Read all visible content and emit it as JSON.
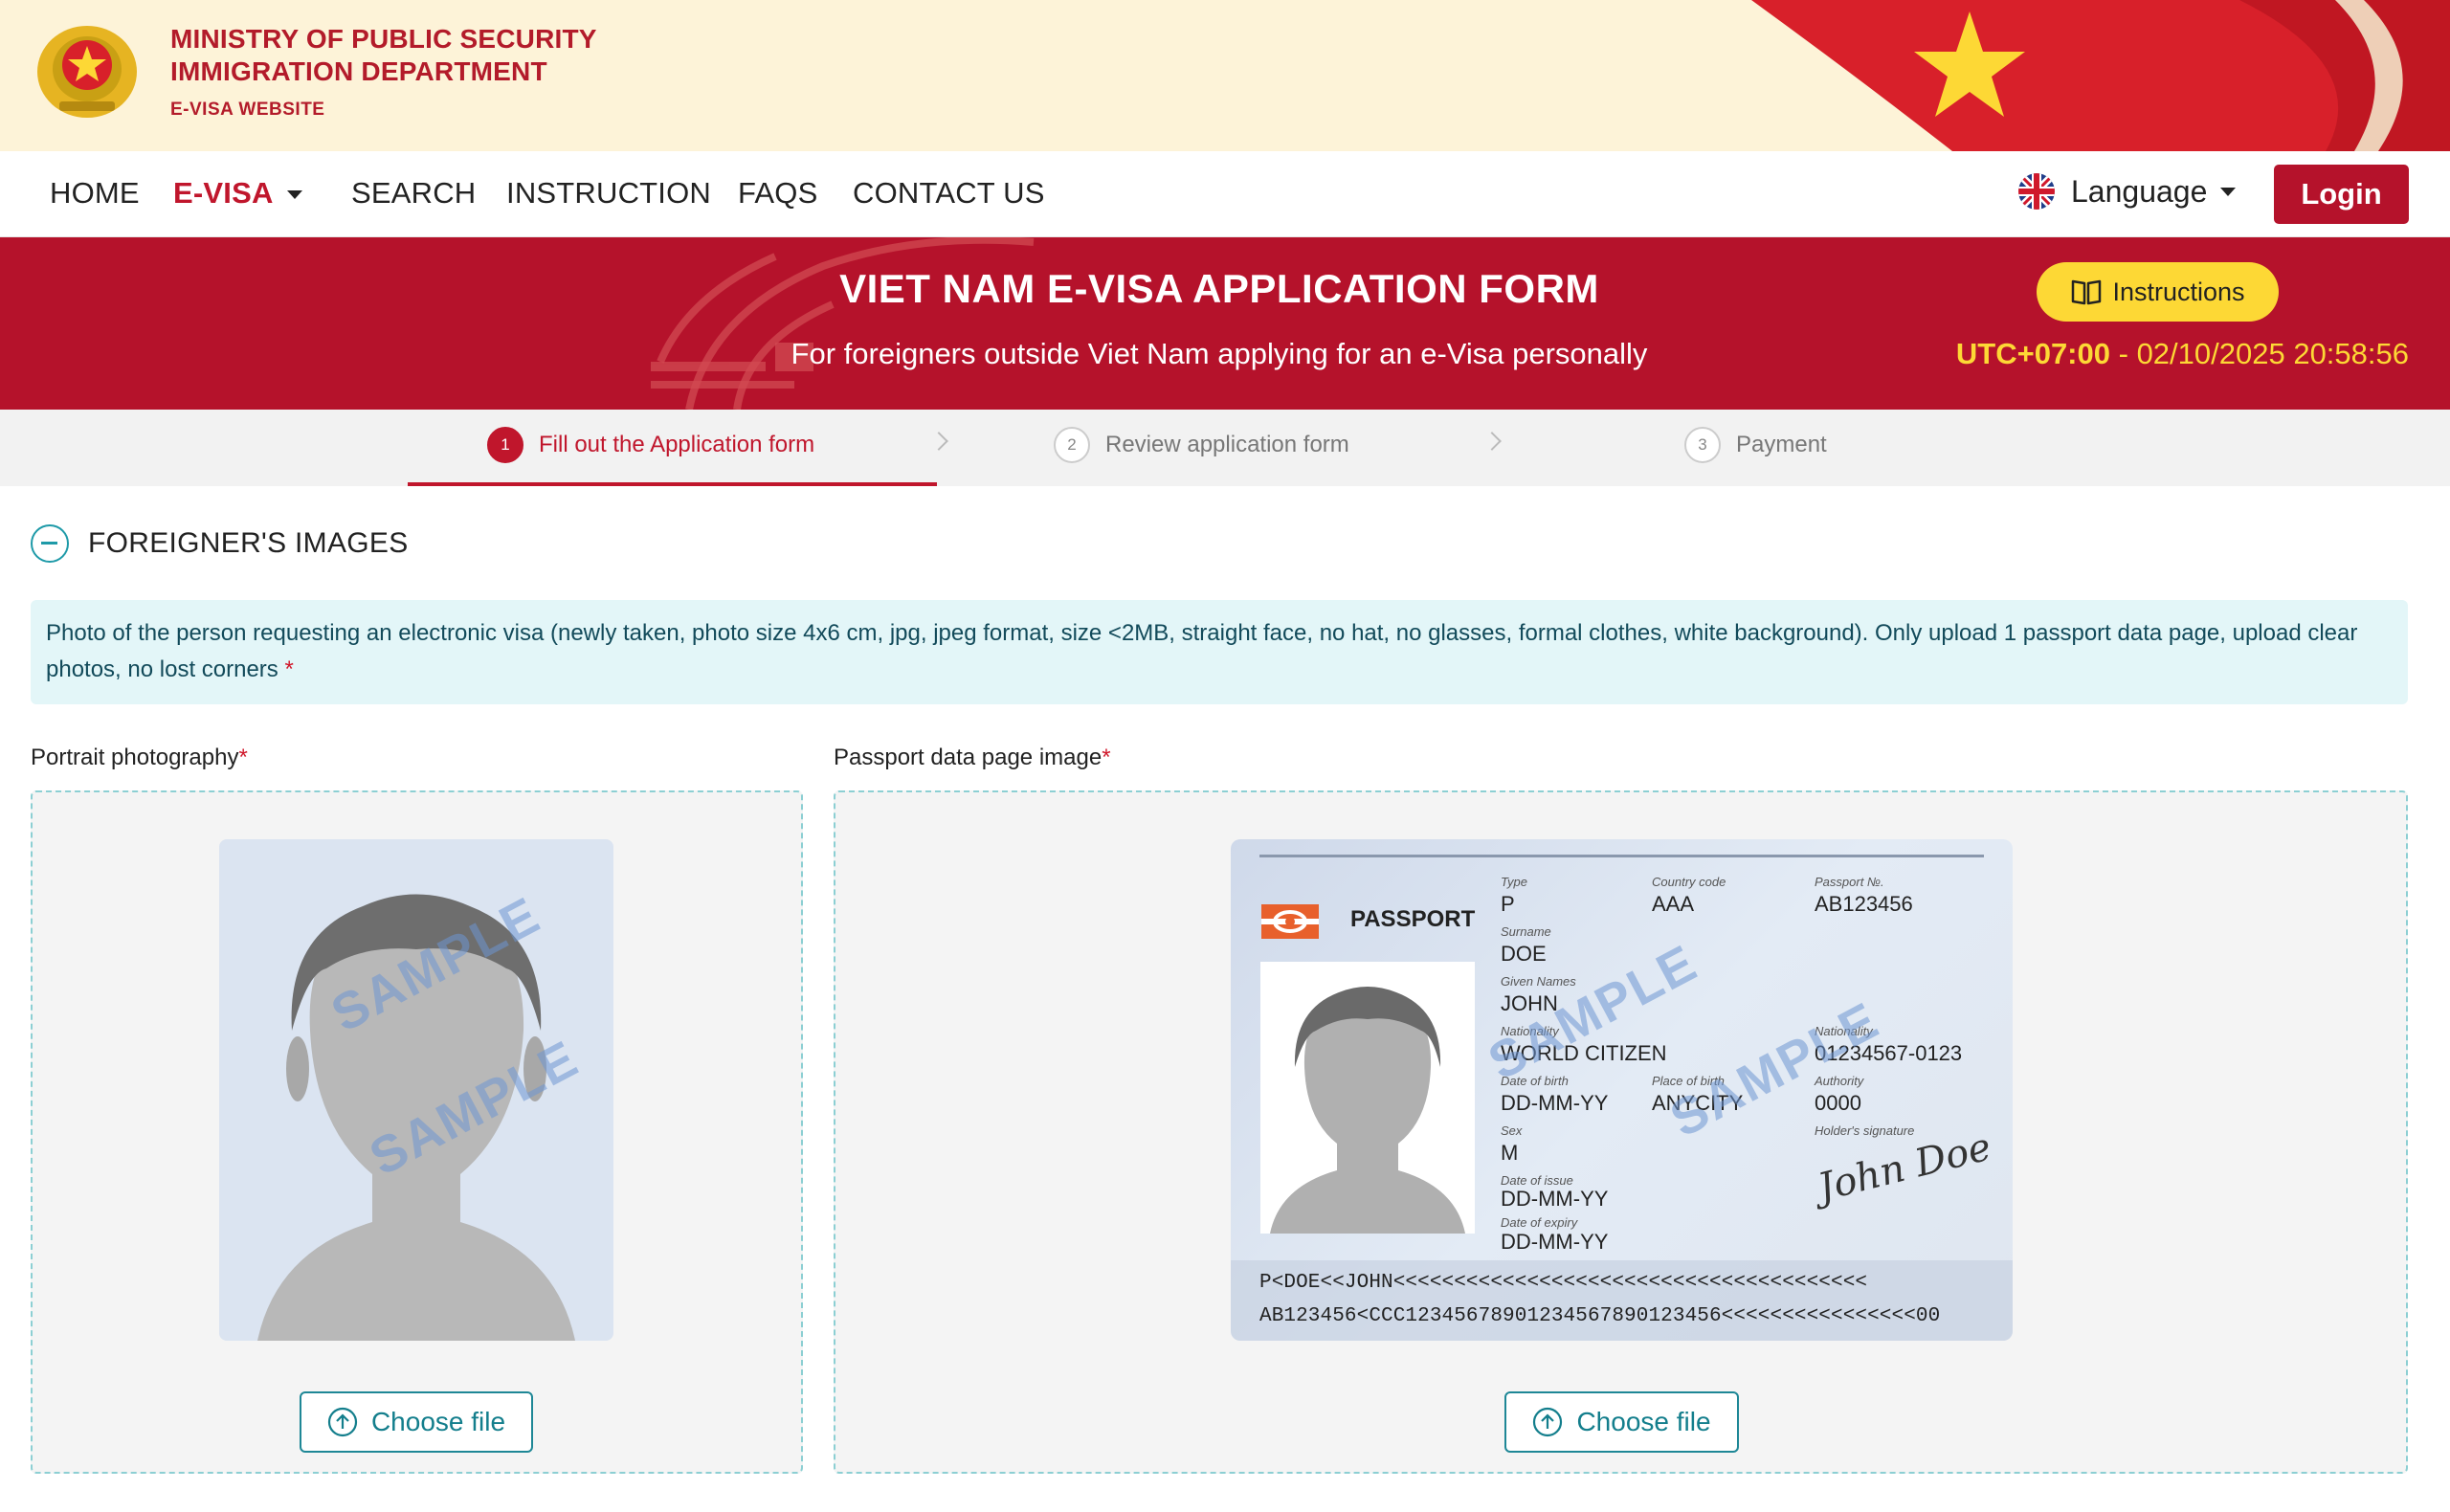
{
  "header": {
    "line1": "MINISTRY OF PUBLIC SECURITY",
    "line2": "IMMIGRATION DEPARTMENT",
    "line3": "E-VISA WEBSITE"
  },
  "nav": {
    "items": [
      "HOME",
      "E-VISA",
      "SEARCH",
      "INSTRUCTION",
      "FAQS",
      "CONTACT US"
    ],
    "active": "E-VISA",
    "language_label": "Language",
    "login_label": "Login"
  },
  "banner": {
    "title": "VIET NAM E-VISA APPLICATION FORM",
    "subtitle": "For foreigners outside Viet Nam applying for an e-Visa personally",
    "instructions_label": "Instructions",
    "timezone": "UTC+07:00",
    "separator": " - ",
    "datetime": "02/10/2025 20:58:56"
  },
  "steps": [
    {
      "num": "1",
      "label": "Fill out the Application form",
      "active": true
    },
    {
      "num": "2",
      "label": "Review application form",
      "active": false
    },
    {
      "num": "3",
      "label": "Payment",
      "active": false
    }
  ],
  "section": {
    "title": "FOREIGNER'S IMAGES",
    "notice": "Photo of the person requesting an electronic visa (newly taken, photo size 4x6 cm, jpg, jpeg format, size <2MB, straight face, no hat, no glasses, formal clothes, white background). Only upload 1 passport data page, upload clear photos, no lost corners",
    "required_mark": "*"
  },
  "portrait": {
    "label": "Portrait photography",
    "watermark": "SAMPLE",
    "choose_label": "Choose file"
  },
  "passport": {
    "label": "Passport data page image",
    "choose_label": "Choose file",
    "watermark": "SAMPLE",
    "title": "PASSPORT",
    "type_label": "Type",
    "type": "P",
    "country_label": "Country code",
    "country": "AAA",
    "number_label": "Passport №.",
    "number": "AB123456",
    "surname_label": "Surname",
    "surname": "DOE",
    "given_label": "Given Names",
    "given": "JOHN",
    "nationality_label": "Nationality",
    "nationality": "WORLD CITIZEN",
    "personal_label": "Nationality",
    "personal": "01234567-0123",
    "dob_label": "Date of birth",
    "dob": "DD-MM-YY",
    "pob_label": "Place of birth",
    "pob": "ANYCITY",
    "authority_label": "Authority",
    "authority": "0000",
    "sex_label": "Sex",
    "sex": "M",
    "signature_label": "Holder's signature",
    "signature": "John Doe",
    "issue_label": "Date of issue",
    "issue": "DD-MM-YY",
    "expiry_label": "Date of expiry",
    "expiry": "DD-MM-YY",
    "mrz1": "P<DOE<<JOHN<<<<<<<<<<<<<<<<<<<<<<<<<<<<<<<<<<<<<<<",
    "mrz2": "AB123456<CCC12345678901234567890123456<<<<<<<<<<<<<<<<00"
  },
  "colors": {
    "brand_red": "#b5122b",
    "accent_yellow": "#fdd835",
    "teal": "#1e9aa8"
  }
}
